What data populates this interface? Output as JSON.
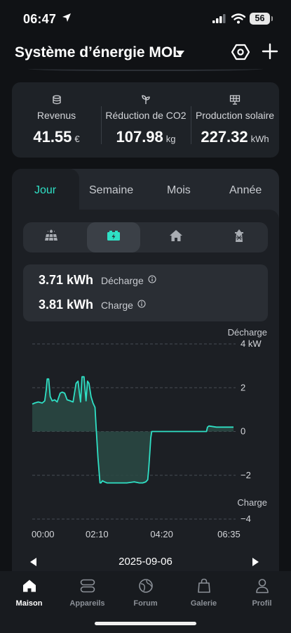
{
  "status_bar": {
    "time": "06:47",
    "battery": "56"
  },
  "header": {
    "title": "Système d’énergie MOL"
  },
  "stats": [
    {
      "icon": "database-icon",
      "label": "Revenus",
      "value": "41.55",
      "unit": "€"
    },
    {
      "icon": "sprout-icon",
      "label": "Réduction de CO2",
      "value": "107.98",
      "unit": "kg"
    },
    {
      "icon": "solar-panel-icon",
      "label": "Production solaire",
      "value": "227.32",
      "unit": "kWh"
    }
  ],
  "tabs": [
    {
      "label": "Jour",
      "active": true
    },
    {
      "label": "Semaine",
      "active": false
    },
    {
      "label": "Mois",
      "active": false
    },
    {
      "label": "Année",
      "active": false
    }
  ],
  "segments": [
    {
      "icon": "solar-panel-icon",
      "active": false
    },
    {
      "icon": "battery-icon",
      "active": true
    },
    {
      "icon": "house-icon",
      "active": false
    },
    {
      "icon": "grid-tower-icon",
      "active": false
    }
  ],
  "summary": {
    "discharge": {
      "value": "3.71 kWh",
      "label": "Décharge"
    },
    "charge": {
      "value": "3.81 kWh",
      "label": "Charge"
    }
  },
  "chart_data": {
    "type": "area",
    "top_label": "Décharge",
    "bottom_label": "Charge",
    "unit": "kW",
    "y_ticks": [
      "4 kW",
      "2",
      "0",
      "−2",
      "−4"
    ],
    "ylim": [
      -4,
      4
    ],
    "x_ticks": [
      "00:00",
      "02:10",
      "04:20",
      "06:35"
    ],
    "x_tick_minutes": [
      0,
      130,
      260,
      395
    ],
    "xlim_minutes": [
      0,
      400
    ],
    "grid": true,
    "line_color": "#2fe0c5",
    "fill_color": "#2a4a44",
    "series": [
      {
        "x_minutes": [
          0,
          5,
          12,
          20,
          25,
          28,
          30,
          33,
          36,
          40,
          45,
          50,
          53,
          56,
          60,
          65,
          70,
          76,
          82,
          88,
          92,
          95,
          97,
          100,
          104,
          106,
          108,
          111,
          114,
          118,
          122,
          126,
          128,
          132,
          136,
          138,
          141,
          145,
          150,
          160,
          175,
          190,
          205,
          215,
          222,
          228,
          232,
          234,
          236,
          238,
          240,
          245,
          260,
          280,
          300,
          320,
          340,
          350,
          352,
          355,
          370,
          395,
          405
        ],
        "y": [
          1.25,
          1.3,
          1.35,
          1.3,
          1.4,
          1.9,
          2.4,
          2.4,
          1.6,
          1.4,
          1.45,
          1.35,
          1.55,
          1.75,
          1.8,
          1.75,
          1.45,
          1.4,
          1.35,
          2.2,
          2.3,
          1.7,
          1.35,
          2.5,
          2.5,
          1.9,
          1.4,
          2.3,
          2.2,
          1.6,
          1.3,
          1.1,
          0.3,
          -1.2,
          -2.35,
          -2.35,
          -2.25,
          -2.3,
          -2.35,
          -2.35,
          -2.35,
          -2.35,
          -2.3,
          -2.35,
          -2.35,
          -2.3,
          -2.2,
          -1.7,
          -1.0,
          -0.3,
          0.0,
          0.0,
          0.0,
          0.0,
          0.0,
          0.0,
          0.0,
          0.0,
          0.2,
          0.25,
          0.2,
          0.2,
          0.2
        ]
      }
    ]
  },
  "date_nav": {
    "date": "2025-09-06"
  },
  "tabbar": [
    {
      "label": "Maison",
      "icon": "home-icon",
      "active": true
    },
    {
      "label": "Appareils",
      "icon": "devices-icon",
      "active": false
    },
    {
      "label": "Forum",
      "icon": "forum-icon",
      "active": false
    },
    {
      "label": "Galerie",
      "icon": "gallery-bag-icon",
      "active": false
    },
    {
      "label": "Profil",
      "icon": "profile-icon",
      "active": false
    }
  ]
}
